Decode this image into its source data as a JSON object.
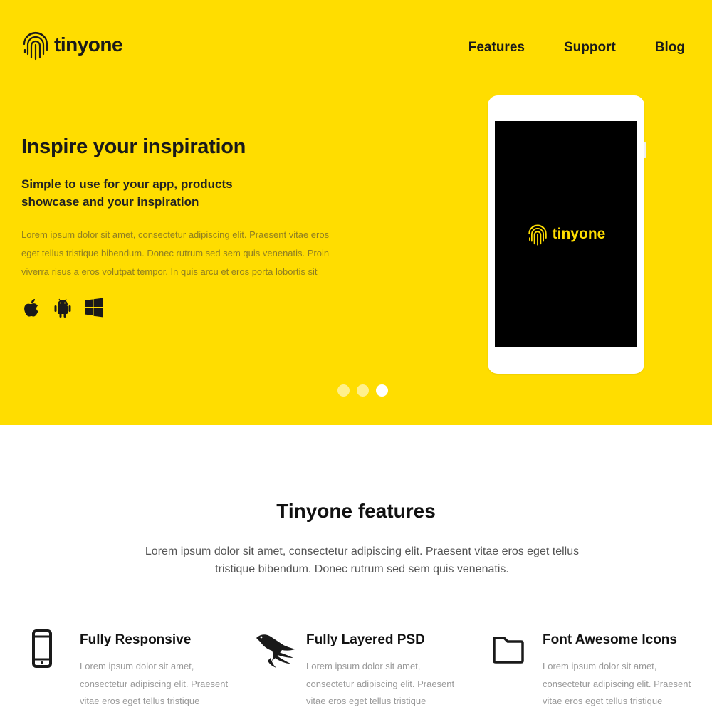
{
  "brand": {
    "name": "tinyone",
    "logo_icon": "fingerprint-icon"
  },
  "nav": {
    "items": [
      {
        "label": "Features"
      },
      {
        "label": "Support"
      },
      {
        "label": "Blog"
      }
    ]
  },
  "hero": {
    "title": "Inspire your inspiration",
    "subtitle": "Simple to use for your app, products showcase and your inspiration",
    "body": "Lorem ipsum dolor sit amet, consectetur adipiscing elit. Praesent vitae eros eget tellus tristique bibendum. Donec rutrum sed sem quis venenatis. Proin viverra risus a eros volutpat tempor. In quis arcu et eros porta lobortis sit",
    "platforms": [
      "apple-icon",
      "android-icon",
      "windows-icon"
    ],
    "device_brand": "tinyone",
    "slider": {
      "count": 3,
      "active": 3
    }
  },
  "features": {
    "title": "Tinyone features",
    "intro": "Lorem ipsum dolor sit amet, consectetur adipiscing elit. Praesent vitae eros eget tellus tristique bibendum. Donec rutrum sed sem quis venenatis.",
    "items": [
      {
        "icon": "mobile-phone-icon",
        "title": "Fully Responsive",
        "body": "Lorem ipsum dolor sit amet, consectetur adipiscing elit. Praesent vitae eros eget tellus tristique"
      },
      {
        "icon": "bird-icon",
        "title": "Fully Layered PSD",
        "body": "Lorem ipsum dolor sit amet, consectetur adipiscing elit. Praesent vitae eros eget tellus tristique"
      },
      {
        "icon": "folder-icon",
        "title": "Font Awesome Icons",
        "body": "Lorem ipsum dolor sit amet, consectetur adipiscing elit. Praesent vitae eros eget tellus tristique"
      }
    ]
  },
  "colors": {
    "accent": "#ffdd00",
    "text": "#1a1a1a",
    "muted": "#999999",
    "screen": "#000000"
  }
}
